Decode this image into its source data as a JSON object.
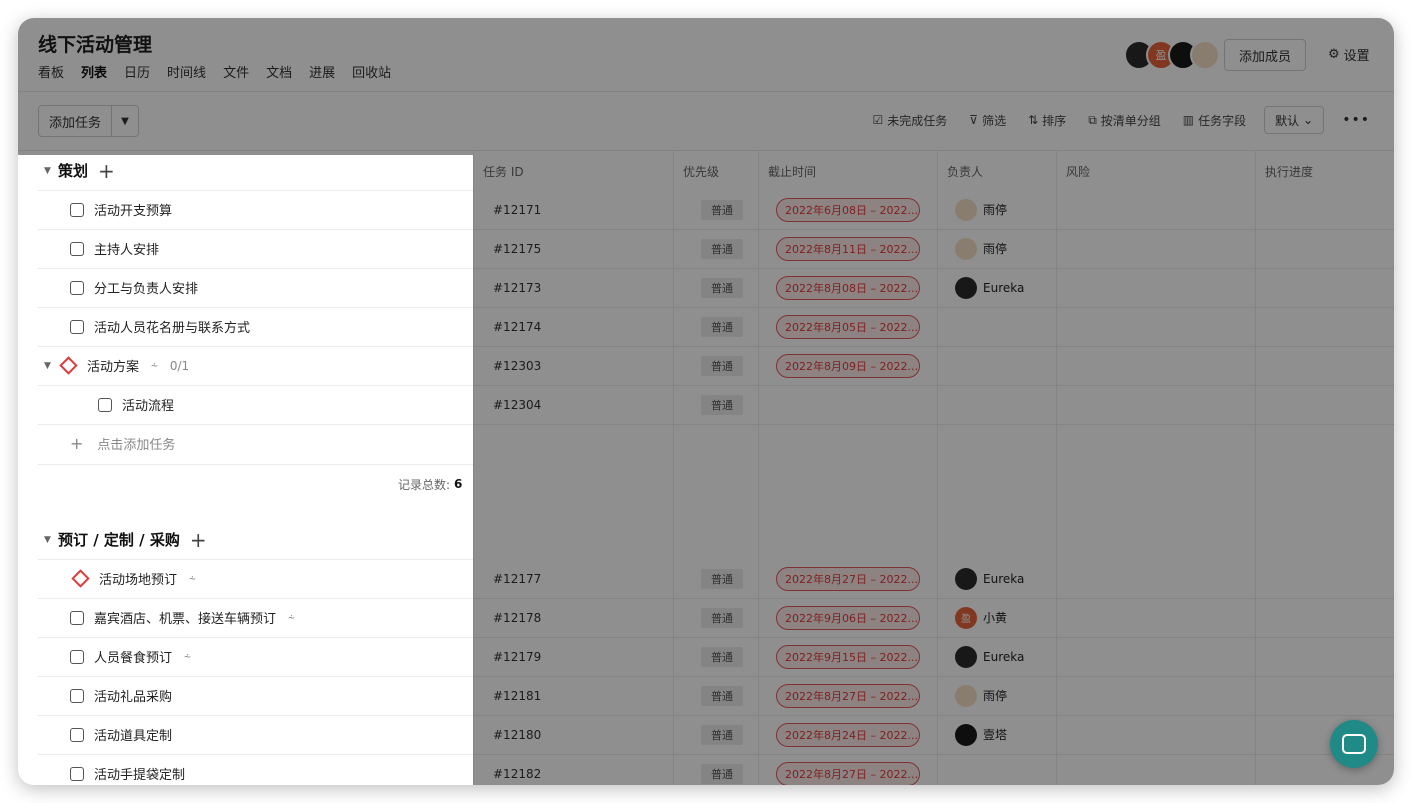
{
  "project": {
    "title": "线下活动管理"
  },
  "nav": [
    "看板",
    "列表",
    "日历",
    "时间线",
    "文件",
    "文档",
    "进展",
    "回收站"
  ],
  "nav_active": "列表",
  "header": {
    "add_member": "添加成员",
    "settings": "设置"
  },
  "toolbar": {
    "add_task": "添加任务",
    "incomplete": "未完成任务",
    "filter": "筛选",
    "sort": "排序",
    "group_by_list": "按清单分组",
    "task_fields": "任务字段",
    "default_view": "默认"
  },
  "columns": [
    "任务 ID",
    "优先级",
    "截止时间",
    "负责人",
    "风险",
    "执行进度"
  ],
  "groups": [
    {
      "name": "策划",
      "tasks": [
        {
          "name": "活动开支预算",
          "id": "#12171",
          "priority": "普通",
          "due": "2022年6月08日 – 2022...",
          "owner": "雨停",
          "owner_avatar": "ygt"
        },
        {
          "name": "主持人安排",
          "id": "#12175",
          "priority": "普通",
          "due": "2022年8月11日 – 2022...",
          "owner": "雨停",
          "owner_avatar": "ygt"
        },
        {
          "name": "分工与负责人安排",
          "id": "#12173",
          "priority": "普通",
          "due": "2022年8月08日 – 2022...",
          "owner": "Eureka",
          "owner_avatar": "eureka"
        },
        {
          "name": "活动人员花名册与联系方式",
          "id": "#12174",
          "priority": "普通",
          "due": "2022年8月05日 – 2022...",
          "owner": "",
          "owner_avatar": ""
        },
        {
          "name": "活动方案",
          "id": "#12303",
          "priority": "普通",
          "due": "2022年8月09日 – 2022...",
          "owner": "",
          "owner_avatar": "",
          "milestone": true,
          "expanded": true,
          "subtask_count": "0/1"
        },
        {
          "name": "活动流程",
          "id": "#12304",
          "priority": "普通",
          "due": "",
          "owner": "",
          "owner_avatar": "",
          "child": true
        }
      ],
      "add_task_label": "点击添加任务",
      "summary_label": "记录总数:",
      "summary_count": "6"
    },
    {
      "name": "预订 / 定制 / 采购",
      "tasks": [
        {
          "name": "活动场地预订",
          "id": "#12177",
          "priority": "普通",
          "due": "2022年8月27日 – 2022...",
          "owner": "Eureka",
          "owner_avatar": "eureka",
          "milestone": true,
          "has_subtasks_icon": true
        },
        {
          "name": "嘉宾酒店、机票、接送车辆预订",
          "id": "#12178",
          "priority": "普通",
          "due": "2022年9月06日 – 2022...",
          "owner": "小黄",
          "owner_avatar": "xh",
          "has_subtasks_icon": true
        },
        {
          "name": "人员餐食预订",
          "id": "#12179",
          "priority": "普通",
          "due": "2022年9月15日 – 2022...",
          "owner": "Eureka",
          "owner_avatar": "eureka",
          "has_subtasks_icon": true
        },
        {
          "name": "活动礼品采购",
          "id": "#12181",
          "priority": "普通",
          "due": "2022年8月27日 – 2022...",
          "owner": "雨停",
          "owner_avatar": "ygt"
        },
        {
          "name": "活动道具定制",
          "id": "#12180",
          "priority": "普通",
          "due": "2022年8月24日 – 2022...",
          "owner": "壹塔",
          "owner_avatar": "yt"
        },
        {
          "name": "活动手提袋定制",
          "id": "#12182",
          "priority": "普通",
          "due": "2022年8月27日 – 2022...",
          "owner": "",
          "owner_avatar": ""
        }
      ]
    }
  ],
  "avatar_colors": {
    "ygt": "#f2dfc7",
    "eureka": "#2c2c2c",
    "xh": "#e8643a",
    "yt": "#1a1a1a"
  },
  "avatar_glyphs": {
    "xh": "盈"
  },
  "header_avatars": [
    "eureka",
    "xh",
    "yt",
    "ygt"
  ]
}
